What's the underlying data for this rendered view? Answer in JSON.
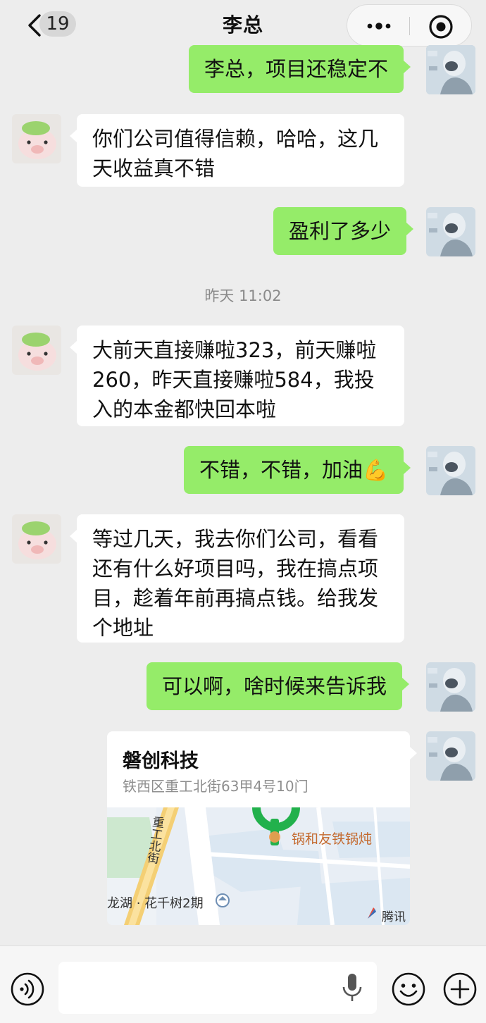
{
  "header": {
    "unread_count": "19",
    "title": "李总"
  },
  "messages": [
    {
      "side": "out",
      "text": "李总，项目还稳定不"
    },
    {
      "side": "in",
      "text": "你们公司值得信赖，哈哈，这几天收益真不错"
    },
    {
      "side": "out",
      "text": "盈利了多少"
    },
    {
      "side": "in",
      "text": "大前天直接赚啦323，前天赚啦260，昨天直接赚啦584，我投入的本金都快回本啦"
    },
    {
      "side": "out",
      "text": "不错，不错，加油💪"
    },
    {
      "side": "in",
      "text": "等过几天，我去你们公司，看看还有什么好项目吗，我在搞点项目，趁着年前再搞点钱。给我发个地址"
    },
    {
      "side": "out",
      "text": "可以啊，啥时候来告诉我"
    }
  ],
  "timestamp": "昨天 11:02",
  "incoming_lines": {
    "msg2": [
      "你们公司值得信赖，哈哈，这几",
      "天收益真不错"
    ],
    "msg4": [
      "大前天直接赚啦323，前天赚啦",
      "260，昨天直接赚啦584，我投",
      "入的本金都快回本啦"
    ],
    "msg6": [
      "等过几天，我去你们公司，看看",
      "还有什么好项目吗，我在搞点项",
      "目，趁着年前再搞点钱。给我发",
      "个地址"
    ]
  },
  "location": {
    "name": "磐创科技",
    "address": "铁西区重工北街63甲4号10门",
    "map_labels": {
      "street": "重工北街",
      "poi": "锅和友铁锅炖",
      "area": "龙湖 · 花千树2期",
      "provider": "腾讯"
    }
  },
  "input": {
    "placeholder": ""
  },
  "icons": {
    "back": "chevron-left-icon",
    "more": "more-dots-icon",
    "target": "target-icon",
    "voice": "voice-icon",
    "mic": "mic-icon",
    "emoji": "emoji-icon",
    "plus": "plus-icon"
  },
  "colors": {
    "background": "#ededed",
    "outgoing_bubble": "#95ec69",
    "incoming_bubble": "#ffffff",
    "map_pin": "#22b14c"
  }
}
